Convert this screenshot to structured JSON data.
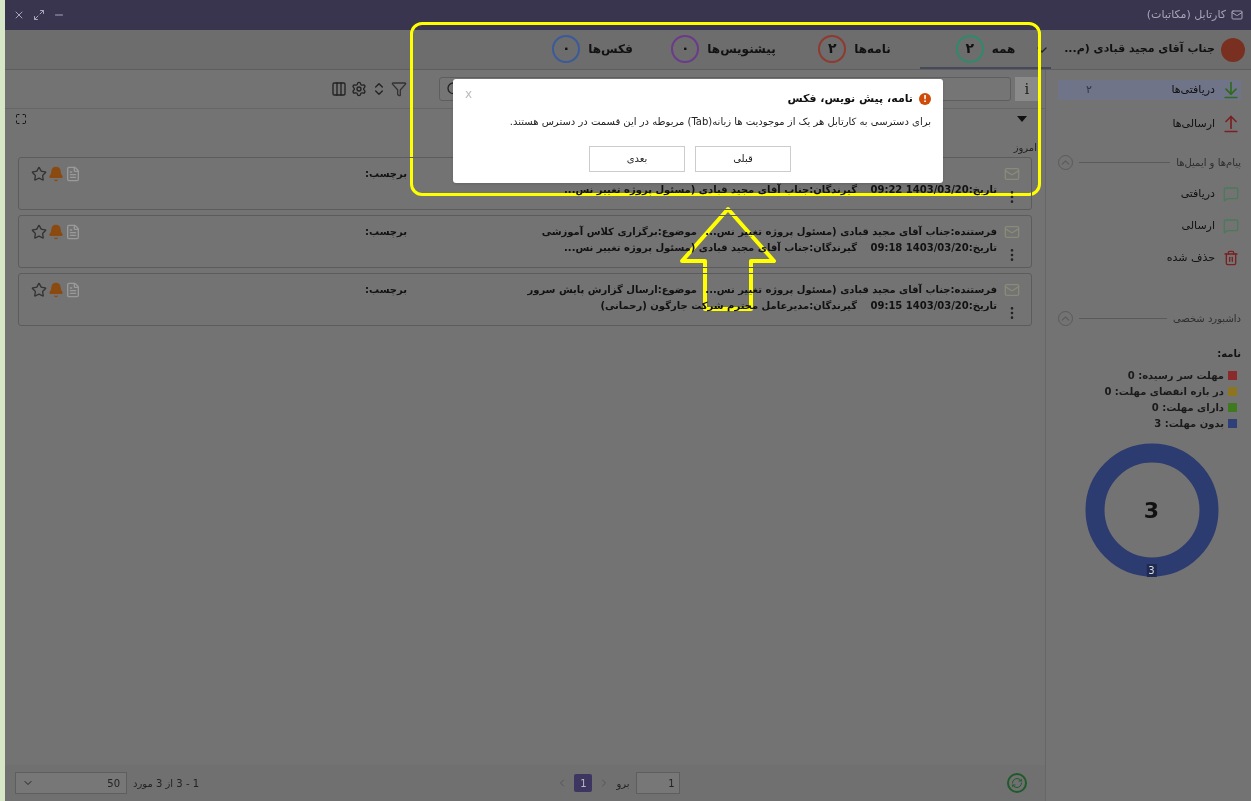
{
  "window": {
    "title": "کارتابل (مکاتبات)"
  },
  "user": {
    "name": "جناب آقای مجید قبادی (م..."
  },
  "tabs": [
    {
      "label": "همه",
      "count": "۲",
      "color": "#2f8a6c",
      "selected": true
    },
    {
      "label": "نامه‌ها",
      "count": "۲",
      "color": "#8e3a2e",
      "selected": false
    },
    {
      "label": "پیشنویس‌ها",
      "count": "۰",
      "color": "#6b3a8a",
      "selected": false
    },
    {
      "label": "فکس‌ها",
      "count": "۰",
      "color": "#3a5a9a",
      "selected": false
    }
  ],
  "toolbar": {
    "info": "i"
  },
  "group_label": "امروز",
  "cards": [
    {
      "date": "تاریخ:1403/03/20 09:22",
      "recipients": "گیرندگان:جناب آقای مجید قبادی (مسئول پروژه تغییر نس...",
      "label": "برچسب:"
    },
    {
      "sender": "فرستنده:جناب آقای مجید قبادی (مسئول پروژه تغییر نس...",
      "subject": "موضوع:برگزاری کلاس آموزشی",
      "date": "تاریخ:1403/03/20 09:18",
      "recipients": "گیرندگان:جناب آقای مجید قبادی (مسئول پروژه تغییر نس...",
      "label": "برچسب:"
    },
    {
      "sender": "فرستنده:جناب آقای مجید قبادی (مسئول پروژه تغییر نس...",
      "subject": "موضوع:ارسال گزارش پایش سرور",
      "date": "تاریخ:1403/03/20 09:15",
      "recipients": "گیرندگان:مدیرعامل محترم شرکت جارگون (رحمانی)",
      "label": "برچسب:"
    }
  ],
  "footer": {
    "page_size": "50",
    "summary": "1 - 3 از 3 مورد",
    "pages": [
      {
        "label": "1",
        "selected": true
      }
    ],
    "go_label": "برو",
    "go_value": "1"
  },
  "sidebar": {
    "items": [
      {
        "kind": "inbox",
        "label": "دریافتی‌ها",
        "count": "۲",
        "selected": true
      },
      {
        "kind": "outbox",
        "label": "ارسالی‌ها",
        "selected": false
      }
    ],
    "sections": [
      {
        "title": "پیام‌ها و ایمیل‌ها",
        "items": [
          {
            "kind": "msg-in",
            "label": "دریافتی"
          },
          {
            "kind": "msg-out",
            "label": "ارسالی"
          },
          {
            "kind": "trash",
            "label": "حذف شده"
          }
        ]
      },
      {
        "title": "داشبورد شخصی"
      }
    ],
    "legend_title": "نامه:",
    "legend": [
      {
        "label": "مهلت سر رسیده: 0",
        "color": "#8a2a2a"
      },
      {
        "label": "در بازه انقضای مهلت: 0",
        "color": "#8c7420"
      },
      {
        "label": "دارای مهلت: 0",
        "color": "#3f7a1f"
      },
      {
        "label": "بدون مهلت: 3",
        "color": "#2f4079"
      }
    ],
    "donut": {
      "center": "3",
      "slice_label": "3"
    }
  },
  "tour": {
    "icon": "!",
    "title": "نامه، پیش نویس، فکس",
    "body": "برای دسترسی به کارتابل هر یک از موجودیت ها زبانه(Tab) مربوطه در این قسمت در دسترس هستند.",
    "close": "x",
    "buttons": [
      "قبلی",
      "بعدی"
    ]
  }
}
